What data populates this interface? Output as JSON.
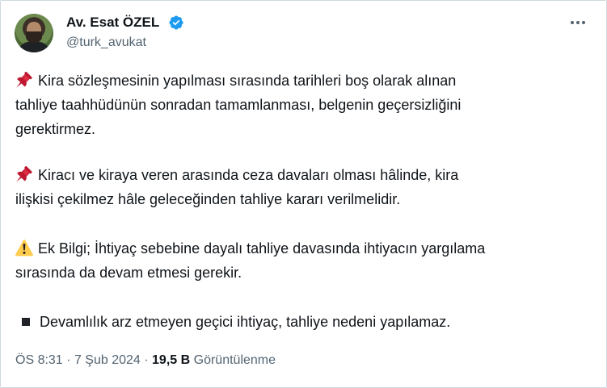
{
  "author": {
    "name": "Av. Esat ÖZEL",
    "handle": "@turk_avukat",
    "verified_color": "#1d9bf0"
  },
  "icons": {
    "pin": "pushpin-icon",
    "warning": "warning-icon",
    "bullet": "black-square-icon",
    "more": "more-options-icon",
    "verified": "verified-badge-icon"
  },
  "tweet": {
    "paragraphs": [
      {
        "icon": "pushpin-icon",
        "lines": [
          "Kira sözleşmesinin yapılması sırasında tarihleri boş olarak alınan",
          "tahliye taahhüdünün sonradan tamamlanması, belgenin geçersizliğini",
          "gerektirmez."
        ]
      },
      {
        "icon": "pushpin-icon",
        "lines": [
          "Kiracı ve kiraya veren arasında ceza davaları olması hâlinde, kira",
          "ilişkisi çekilmez hâle geleceğinden tahliye kararı verilmelidir."
        ]
      },
      {
        "icon": "warning-icon",
        "lines": [
          "Ek Bilgi; İhtiyaç sebebine dayalı tahliye davasında ihtiyacın yargılama",
          "sırasında da devam etmesi gerekir."
        ]
      },
      {
        "icon": "black-square-icon",
        "lines": [
          "Devamlılık arz etmeyen geçici ihtiyaç, tahliye nedeni yapılamaz."
        ]
      }
    ]
  },
  "meta": {
    "time": "ÖS 8:31",
    "separator": "·",
    "date": "7 Şub 2024",
    "views_count": "19,5 B",
    "views_label": "Görüntülenme"
  }
}
